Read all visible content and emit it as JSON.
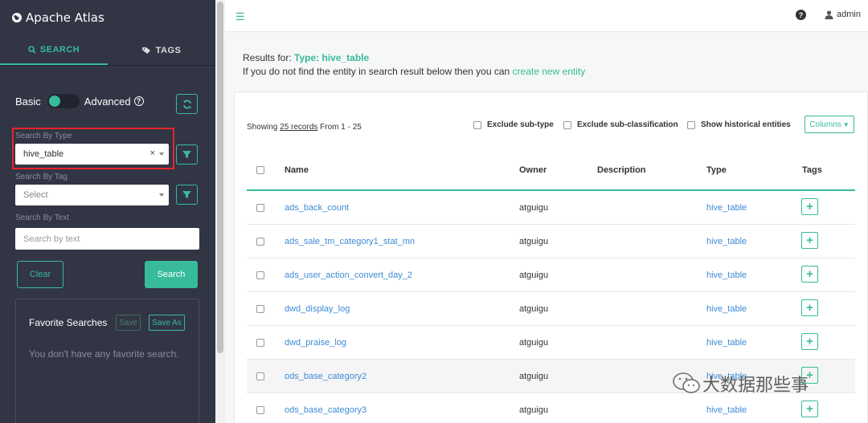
{
  "brand": {
    "title": "Apache Atlas",
    "icon": "globe-icon"
  },
  "tabs": [
    {
      "label": "SEARCH",
      "icon": "search-icon"
    },
    {
      "label": "TAGS",
      "icon": "tag-icon"
    }
  ],
  "toggle": {
    "basic": "Basic",
    "advanced": "Advanced",
    "state": "basic"
  },
  "search_by_type": {
    "label": "Search By Type",
    "value": "hive_table"
  },
  "search_by_tag": {
    "label": "Search By Tag",
    "placeholder": "Select"
  },
  "search_by_text": {
    "label": "Search By Text",
    "placeholder": "Search by text"
  },
  "buttons": {
    "clear": "Clear",
    "search": "Search"
  },
  "favorites": {
    "title": "Favorite Searches",
    "save": "Save",
    "save_as": "Save As",
    "empty": "You don't have any favorite search."
  },
  "topbar": {
    "menu_icon": "hamburger-icon",
    "help_icon": "question-icon",
    "user": "admin"
  },
  "results": {
    "prefix": "Results for:",
    "type_label": "Type:",
    "type_value": "hive_table",
    "hint": "If you do not find the entity in search result below then you can",
    "create_link": "create new entity"
  },
  "listing": {
    "showing_prefix": "Showing",
    "records": "25 records",
    "range": "From 1 - 25",
    "exclude_subtype": "Exclude sub-type",
    "exclude_subclass": "Exclude sub-classification",
    "show_historical": "Show historical entities",
    "columns": "Columns"
  },
  "table": {
    "headers": {
      "name": "Name",
      "owner": "Owner",
      "description": "Description",
      "type": "Type",
      "tags": "Tags"
    },
    "rows": [
      {
        "name": "ads_back_count",
        "owner": "atguigu",
        "description": "",
        "type": "hive_table"
      },
      {
        "name": "ads_sale_tm_category1_stat_mn",
        "owner": "atguigu",
        "description": "",
        "type": "hive_table"
      },
      {
        "name": "ads_user_action_convert_day_2",
        "owner": "atguigu",
        "description": "",
        "type": "hive_table"
      },
      {
        "name": "dwd_display_log",
        "owner": "atguigu",
        "description": "",
        "type": "hive_table"
      },
      {
        "name": "dwd_praise_log",
        "owner": "atguigu",
        "description": "",
        "type": "hive_table"
      },
      {
        "name": "ods_base_category2",
        "owner": "atguigu",
        "description": "",
        "type": "hive_table"
      },
      {
        "name": "ods_base_category3",
        "owner": "atguigu",
        "description": "",
        "type": "hive_table"
      }
    ]
  },
  "watermark": "大数据那些事",
  "colors": {
    "accent": "#37bb9b",
    "sidebar": "#323544",
    "link": "#3e8bd6",
    "highlight": "#e8252c"
  }
}
